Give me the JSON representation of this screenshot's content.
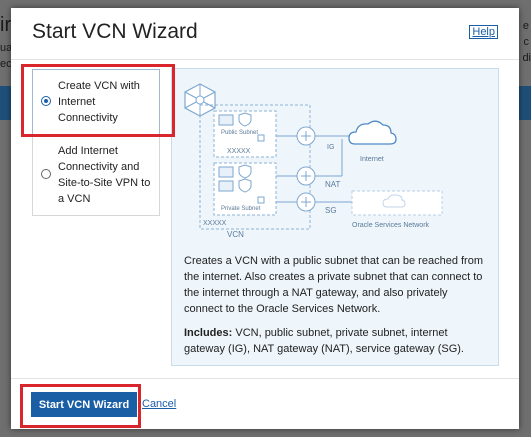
{
  "background": {
    "left_fragments": [
      "ir",
      "ua",
      "ec"
    ],
    "right_fragments": [
      "e",
      "c",
      "di"
    ]
  },
  "modal": {
    "title": "Start VCN Wizard",
    "help_label": "Help"
  },
  "options": [
    {
      "label": "Create VCN with Internet Connectivity",
      "selected": true
    },
    {
      "label": "Add Internet Connectivity and Site-to-Site VPN to a VCN",
      "selected": false
    }
  ],
  "diagram": {
    "public_subnet": "Public Subnet",
    "private_subnet": "Private Subnet",
    "vcn": "VCN",
    "internet": "Internet",
    "ig": "IG",
    "nat": "NAT",
    "sg": "SG",
    "oracle_services": "Oracle Services Network",
    "masked": "XXXXX"
  },
  "description": {
    "text": "Creates a VCN with a public subnet that can be reached from the internet. Also creates a private subnet that can connect to the internet through a NAT gateway, and also privately connect to the Oracle Services Network.",
    "includes_label": "Includes:",
    "includes_text": " VCN, public subnet, private subnet, internet gateway (IG), NAT gateway (NAT), service gateway (SG)."
  },
  "footer": {
    "primary_label": "Start VCN Wizard",
    "cancel_label": "Cancel"
  },
  "colors": {
    "primary": "#1a5ea6",
    "highlight": "#d9262c",
    "panel_bg": "#eef5fb"
  }
}
